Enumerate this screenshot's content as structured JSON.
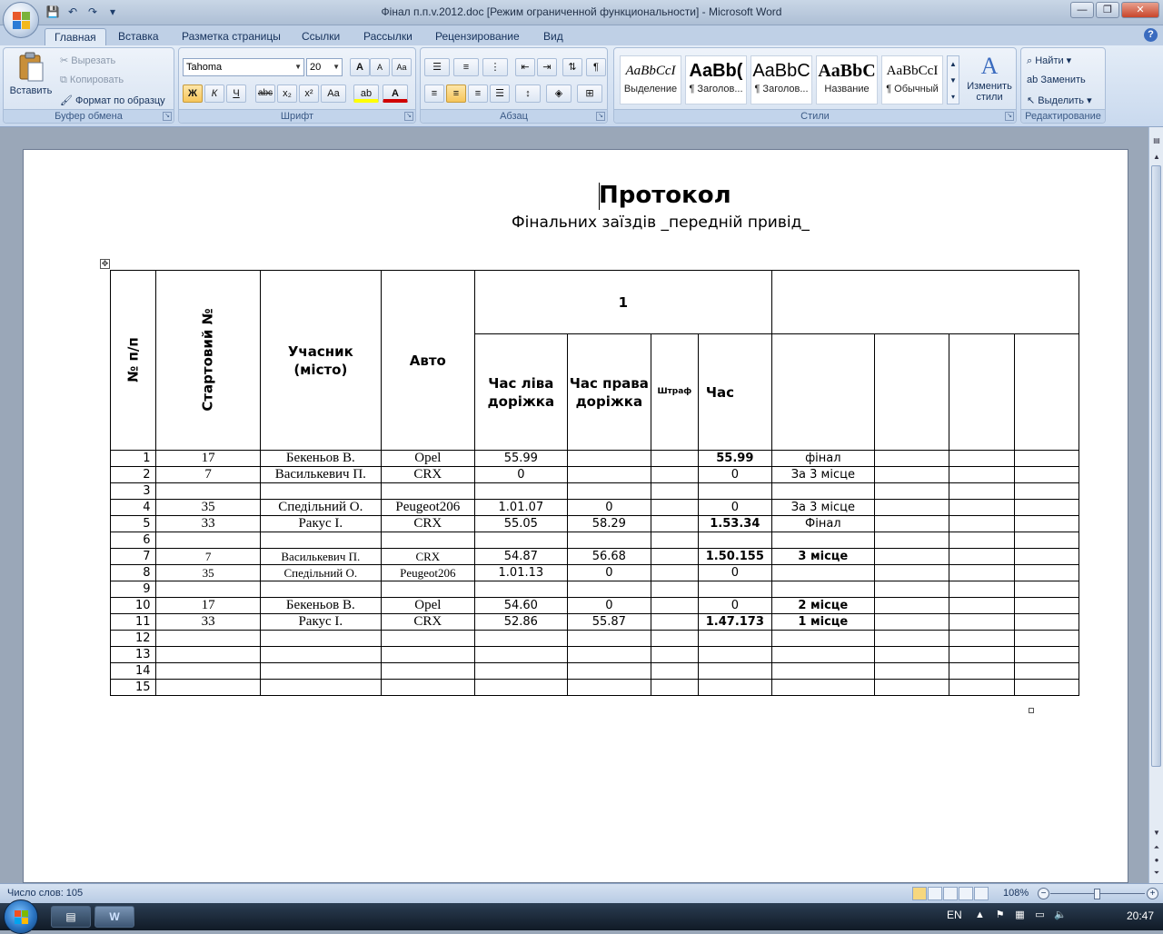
{
  "window": {
    "title": "Фінал п.п.v.2012.doc [Режим ограниченной функциональности] - Microsoft Word",
    "controls": {
      "minimize": "—",
      "maximize": "❐",
      "close": "✕"
    }
  },
  "qat": {
    "save": "💾",
    "undo": "↶",
    "redo": "↷",
    "more": "▾"
  },
  "tabs": [
    {
      "label": "Главная",
      "active": true
    },
    {
      "label": "Вставка"
    },
    {
      "label": "Разметка страницы"
    },
    {
      "label": "Ссылки"
    },
    {
      "label": "Рассылки"
    },
    {
      "label": "Рецензирование"
    },
    {
      "label": "Вид"
    }
  ],
  "ribbon": {
    "clipboard": {
      "label": "Буфер обмена",
      "paste": "Вставить",
      "cut": "Вырезать",
      "copy": "Копировать",
      "format_painter": "Формат по образцу"
    },
    "font": {
      "label": "Шрифт",
      "font_name": "Tahoma",
      "font_size": "20",
      "grow": "A",
      "shrink": "A",
      "clear": "Aa",
      "bold": "Ж",
      "italic": "К",
      "underline": "Ч",
      "strike": "abc",
      "subscript": "x₂",
      "superscript": "x²",
      "change_case": "Aa",
      "highlight": "ab",
      "font_color": "A",
      "colors": {
        "highlight": "#ffff00",
        "font_color": "#d00000"
      }
    },
    "paragraph": {
      "label": "Абзац"
    },
    "styles": {
      "label": "Стили",
      "items": [
        {
          "sample": "AaBbCcI",
          "name": "Выделение"
        },
        {
          "sample": "AaBb(",
          "name": "¶ Заголов..."
        },
        {
          "sample": "AaBbC",
          "name": "¶ Заголов..."
        },
        {
          "sample": "AaBbC",
          "name": "Название"
        },
        {
          "sample": "AaBbCcI",
          "name": "¶ Обычный"
        }
      ],
      "change_styles": "Изменить стили"
    },
    "editing": {
      "label": "Редактирование",
      "find": "Найти",
      "replace": "Заменить",
      "select": "Выделить"
    }
  },
  "document": {
    "title": "Протокол",
    "subtitle": "Фінальних заїздів _передній привід_",
    "table": {
      "header": {
        "no": "№ п/п",
        "start_no": "Стартовий №",
        "participant": "Учасник (місто)",
        "car": "Авто",
        "group1": "1",
        "left_lane": "Час ліва доріжка",
        "right_lane": "Час права доріжка",
        "penalty": "Штраф",
        "time": "Час"
      },
      "rows": [
        {
          "n": "1",
          "start": "17",
          "name": "Бекеньов В.",
          "car": "Opel",
          "left": "55.99",
          "right": "",
          "penalty": "",
          "time": "55.99",
          "result": "фінал",
          "time_bold": true,
          "result_bold": false,
          "small": false
        },
        {
          "n": "2",
          "start": "7",
          "name": "Василькевич П.",
          "car": "CRX",
          "left": "0",
          "right": "",
          "penalty": "",
          "time": "0",
          "result": "За 3 місце",
          "time_bold": false,
          "result_bold": false,
          "small": false
        },
        {
          "n": "3",
          "start": "",
          "name": "",
          "car": "",
          "left": "",
          "right": "",
          "penalty": "",
          "time": "",
          "result": "",
          "time_bold": false,
          "result_bold": false,
          "small": false
        },
        {
          "n": "4",
          "start": "35",
          "name": "Спедільний О.",
          "car": "Peugeot206",
          "left": "1.01.07",
          "right": "0",
          "penalty": "",
          "time": "0",
          "result": "За 3 місце",
          "time_bold": false,
          "result_bold": false,
          "small": false
        },
        {
          "n": "5",
          "start": "33",
          "name": "Ракус І.",
          "car": "CRX",
          "left": "55.05",
          "right": "58.29",
          "penalty": "",
          "time": "1.53.34",
          "result": "Фінал",
          "time_bold": true,
          "result_bold": false,
          "small": false
        },
        {
          "n": "6",
          "start": "",
          "name": "",
          "car": "",
          "left": "",
          "right": "",
          "penalty": "",
          "time": "",
          "result": "",
          "time_bold": false,
          "result_bold": false,
          "small": false
        },
        {
          "n": "7",
          "start": "7",
          "name": "Василькевич  П.",
          "car": "CRX",
          "left": "54.87",
          "right": "56.68",
          "penalty": "",
          "time": "1.50.155",
          "result": "3 місце",
          "time_bold": true,
          "result_bold": true,
          "small": true
        },
        {
          "n": "8",
          "start": "35",
          "name": "Спедільний  О.",
          "car": "Peugeot206",
          "left": "1.01.13",
          "right": "0",
          "penalty": "",
          "time": "0",
          "result": "",
          "time_bold": false,
          "result_bold": false,
          "small": true
        },
        {
          "n": "9",
          "start": "",
          "name": "",
          "car": "",
          "left": "",
          "right": "",
          "penalty": "",
          "time": "",
          "result": "",
          "time_bold": false,
          "result_bold": false,
          "small": false
        },
        {
          "n": "10",
          "start": "17",
          "name": "Бекеньов В.",
          "car": "Opel",
          "left": "54.60",
          "right": "0",
          "penalty": "",
          "time": "0",
          "result": "2 місце",
          "time_bold": false,
          "result_bold": true,
          "small": false
        },
        {
          "n": "11",
          "start": "33",
          "name": "Ракус І.",
          "car": "CRX",
          "left": "52.86",
          "right": "55.87",
          "penalty": "",
          "time": "1.47.173",
          "result": "1 місце",
          "time_bold": true,
          "result_bold": true,
          "small": false
        },
        {
          "n": "12",
          "start": "",
          "name": "",
          "car": "",
          "left": "",
          "right": "",
          "penalty": "",
          "time": "",
          "result": "",
          "time_bold": false,
          "result_bold": false,
          "small": false
        },
        {
          "n": "13",
          "start": "",
          "name": "",
          "car": "",
          "left": "",
          "right": "",
          "penalty": "",
          "time": "",
          "result": "",
          "time_bold": false,
          "result_bold": false,
          "small": false
        },
        {
          "n": "14",
          "start": "",
          "name": "",
          "car": "",
          "left": "",
          "right": "",
          "penalty": "",
          "time": "",
          "result": "",
          "time_bold": false,
          "result_bold": false,
          "small": false
        },
        {
          "n": "15",
          "start": "",
          "name": "",
          "car": "",
          "left": "",
          "right": "",
          "penalty": "",
          "time": "",
          "result": "",
          "time_bold": false,
          "result_bold": false,
          "small": false
        }
      ]
    }
  },
  "statusbar": {
    "words": "Число слов: 105",
    "zoom": "108%",
    "zoom_out": "−",
    "zoom_in": "+"
  },
  "taskbar": {
    "lang": "EN",
    "time": "20:47",
    "word_icon": "W",
    "explorer_icon": "▤"
  }
}
